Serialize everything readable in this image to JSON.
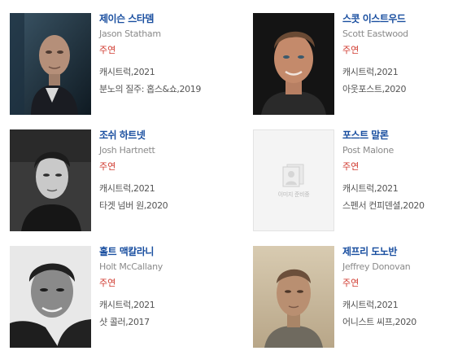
{
  "cast": [
    {
      "name_ko": "제이슨 스타뎀",
      "name_en": "Jason Statham",
      "role": "주연",
      "works": [
        "캐시트럭,2021",
        "분노의 질주: 홉스&쇼,2019"
      ],
      "image": "photo"
    },
    {
      "name_ko": "스콧 이스트우드",
      "name_en": "Scott Eastwood",
      "role": "주연",
      "works": [
        "캐시트럭,2021",
        "아웃포스트,2020"
      ],
      "image": "photo"
    },
    {
      "name_ko": "조쉬 하트넷",
      "name_en": "Josh Hartnett",
      "role": "주연",
      "works": [
        "캐시트럭,2021",
        "타겟 넘버 원,2020"
      ],
      "image": "photo"
    },
    {
      "name_ko": "포스트 말론",
      "name_en": "Post Malone",
      "role": "주연",
      "works": [
        "캐시트럭,2021",
        "스펜서 컨피덴셜,2020"
      ],
      "image": "placeholder",
      "placeholder_text": "이미지 준비중"
    },
    {
      "name_ko": "홀트 맥칼라니",
      "name_en": "Holt McCallany",
      "role": "주연",
      "works": [
        "캐시트럭,2021",
        "샷 콜러,2017"
      ],
      "image": "photo"
    },
    {
      "name_ko": "제프리 도노반",
      "name_en": "Jeffrey Donovan",
      "role": "주연",
      "works": [
        "캐시트럭,2021",
        "어니스트 씨프,2020"
      ],
      "image": "photo"
    }
  ],
  "colors": {
    "name": "#1a4fa0",
    "role": "#d03a2f",
    "english": "#8a8a8a",
    "work": "#555555"
  }
}
